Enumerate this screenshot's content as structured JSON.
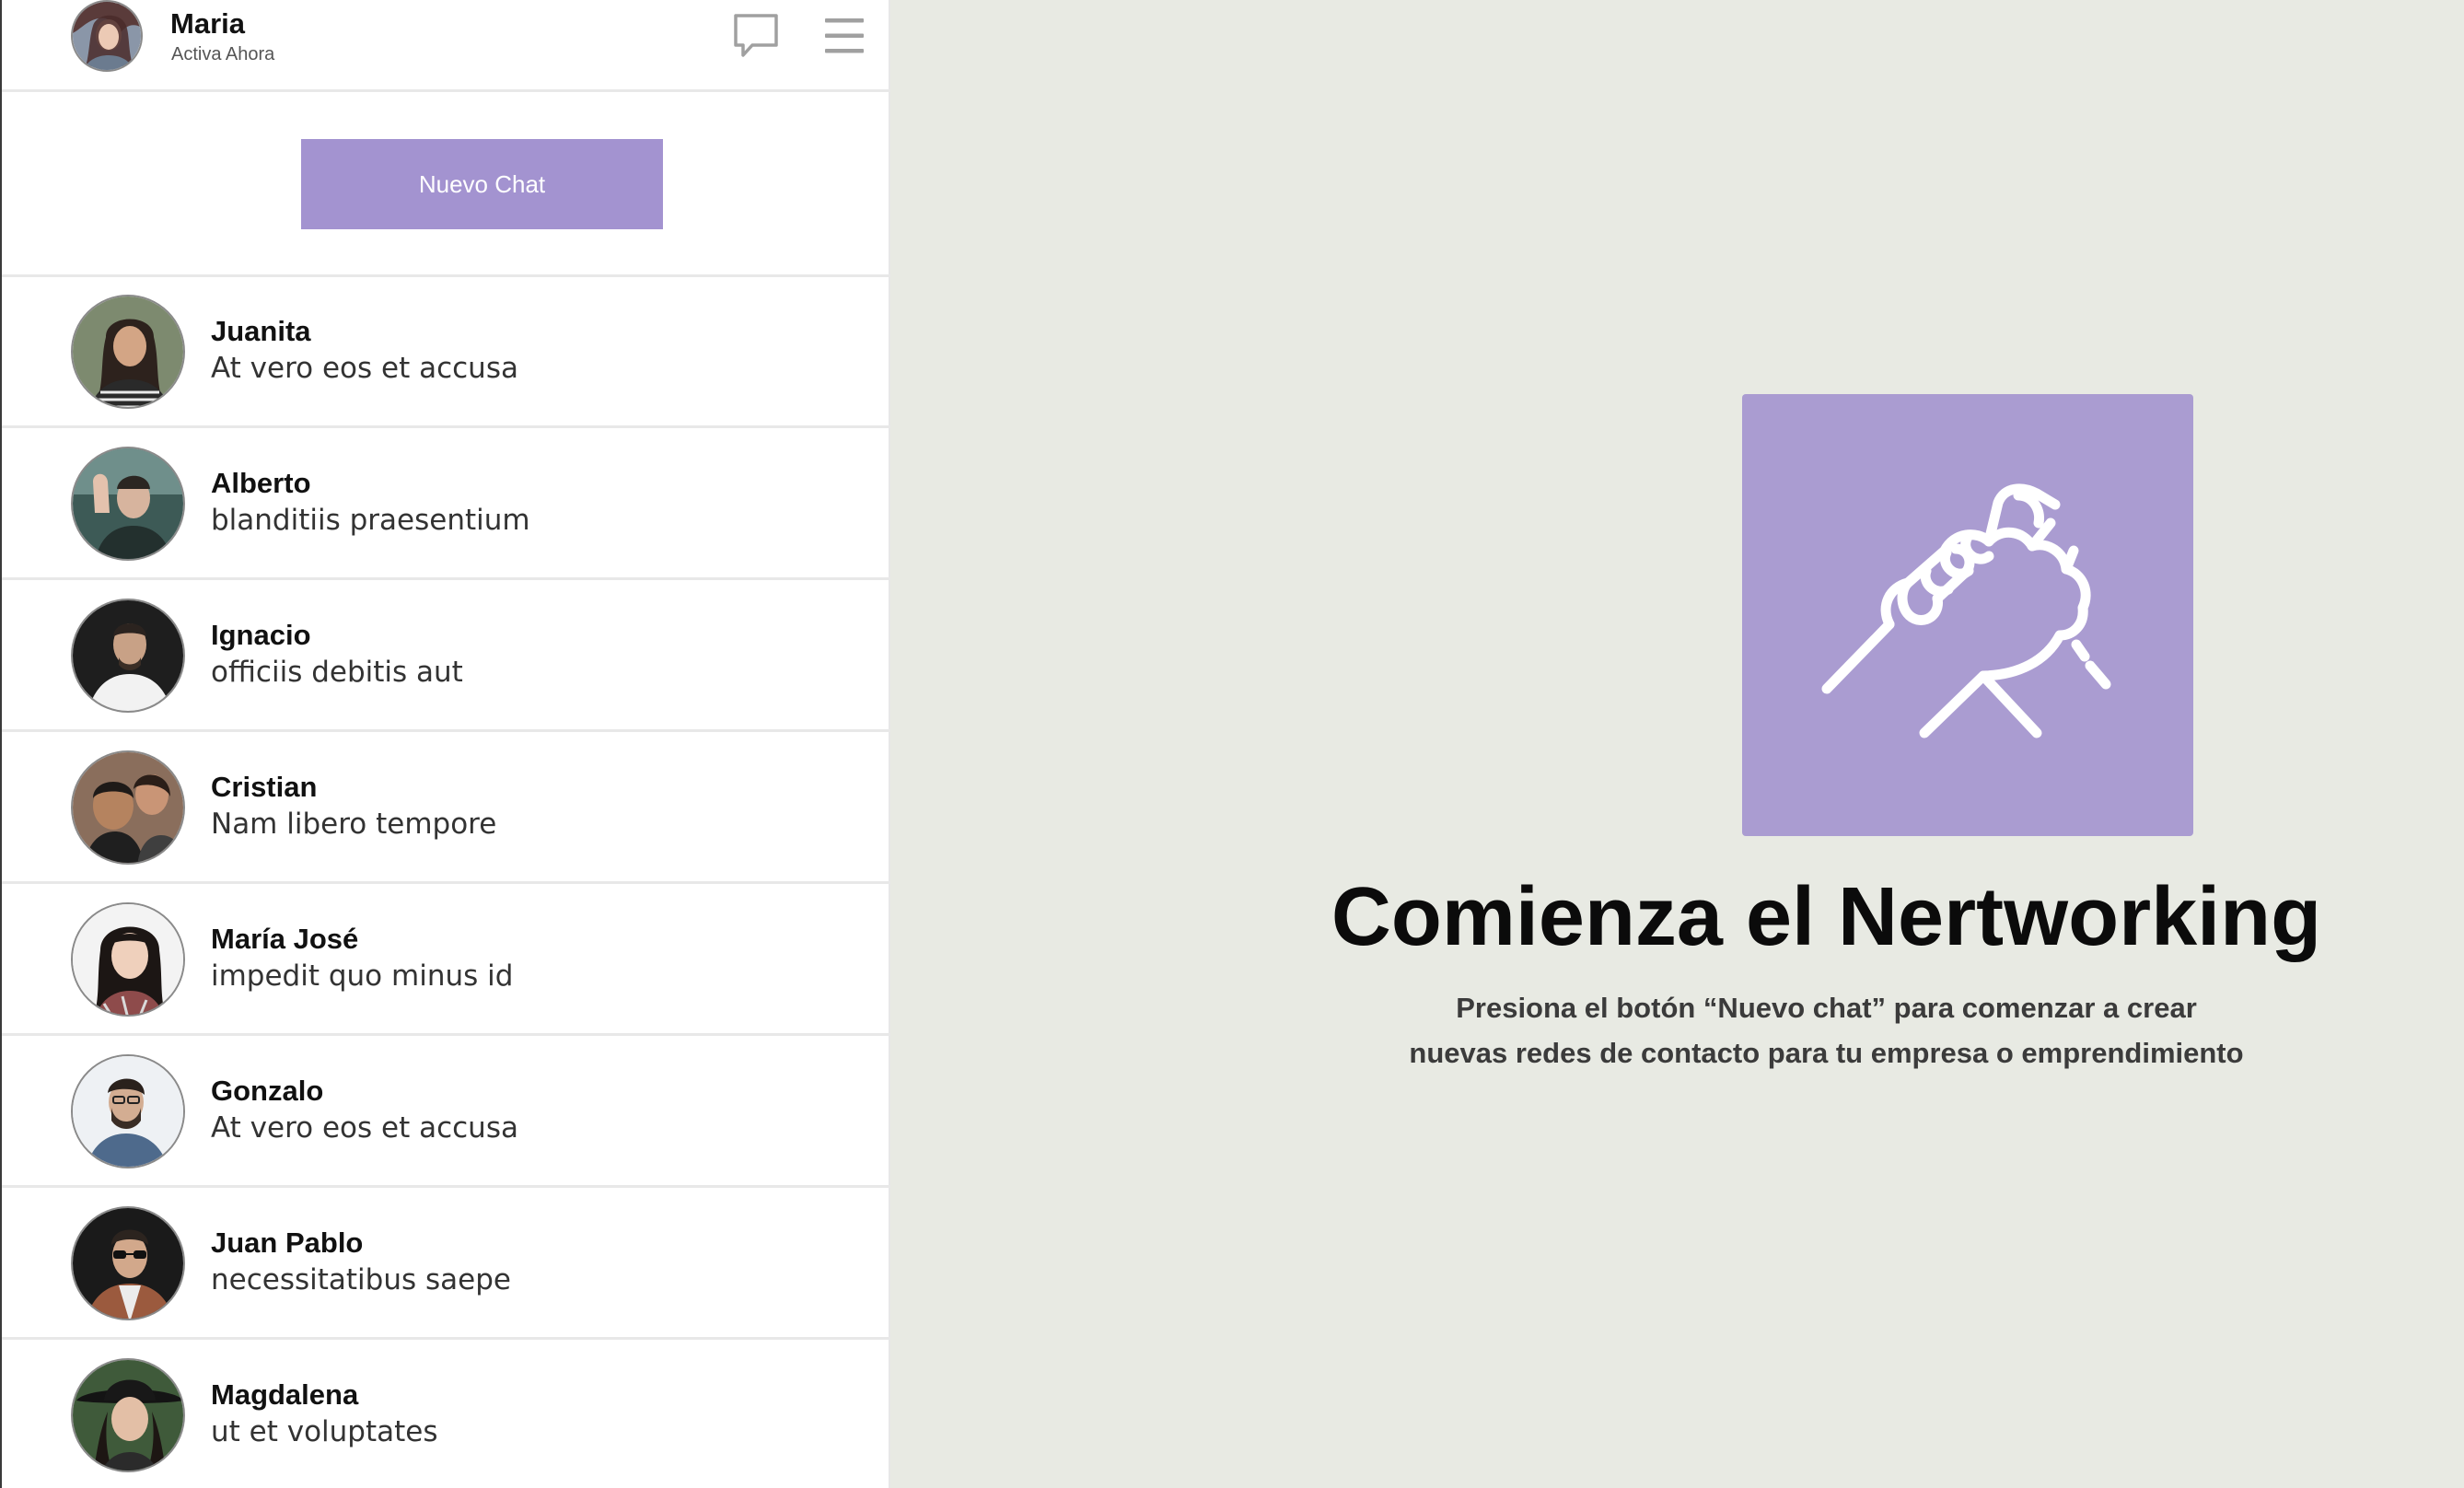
{
  "profile": {
    "name": "Maria",
    "status": "Activa Ahora"
  },
  "actions": {
    "new_chat_label": "Nuevo Chat"
  },
  "chats": [
    {
      "name": "Juanita",
      "message": "At vero eos et accusa"
    },
    {
      "name": "Alberto",
      "message": "blanditiis praesentium"
    },
    {
      "name": "Ignacio",
      "message": "officiis debitis aut"
    },
    {
      "name": "Cristian",
      "message": "Nam libero tempore"
    },
    {
      "name": "María José",
      "message": "impedit quo minus id"
    },
    {
      "name": "Gonzalo",
      "message": "At vero eos et accusa"
    },
    {
      "name": "Juan Pablo",
      "message": "necessitatibus saepe"
    },
    {
      "name": "Magdalena",
      "message": "ut et voluptates"
    }
  ],
  "empty_state": {
    "title": "Comienza el Nertworking",
    "subtitle_line1": "Presiona el botón “Nuevo chat” para comenzar a crear",
    "subtitle_line2": "nuevas redes de contacto para tu empresa o emprendimiento"
  },
  "colors": {
    "accent": "#a393d0",
    "hero_box": "#aa9cd1",
    "main_background": "#e8eae3"
  },
  "icons": {
    "chat": "speech-bubble-icon",
    "menu": "hamburger-menu-icon",
    "hero": "handshake-icon"
  }
}
